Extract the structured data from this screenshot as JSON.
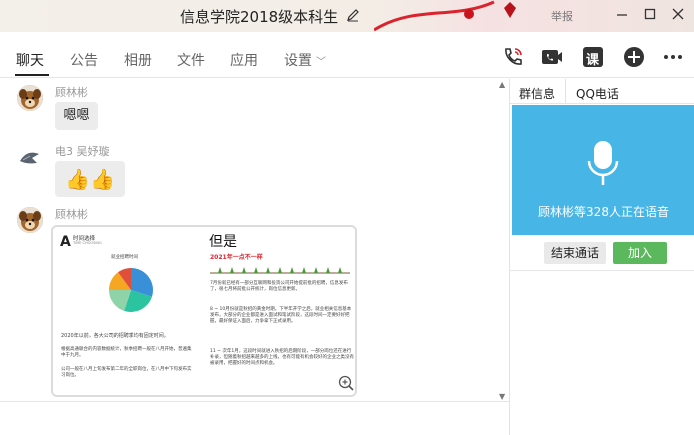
{
  "window": {
    "title": "信息学院2018级本科生",
    "report_label": "举报"
  },
  "tabs": [
    {
      "label": "聊天"
    },
    {
      "label": "公告"
    },
    {
      "label": "相册"
    },
    {
      "label": "文件"
    },
    {
      "label": "应用"
    },
    {
      "label": "设置"
    }
  ],
  "toolbar": {
    "class_label": "课"
  },
  "messages": [
    {
      "sender": "顾林彬",
      "text": "嗯嗯"
    },
    {
      "sender_badge": "电3",
      "sender": "吴妤璇",
      "text": "👍👍"
    },
    {
      "sender": "顾林彬"
    }
  ],
  "image_card": {
    "left": {
      "logo_letter": "A",
      "heading": "时间选择",
      "subheading": "TIME CHOOSING",
      "chart_caption": "就业招聘时间",
      "para1": "2020年以前，各大公司的招聘季均有固定时间。",
      "para2": "根据高通联合的内容数据统计，秋季招聘一般在八月开始，普遍集中于九月。",
      "para3": "公司一般在八月上旬发布第二年的全职岗位，在八月中下旬发布实习岗位。"
    },
    "right": {
      "title": "但是",
      "year_line": "2021年一点不一样",
      "p1": "7月份就已经有一部分互联网和投资公司开始提前批的招聘，信息发布了，很七月将前批公开统计，岗位信息更新。",
      "p2": "8 ~ 10月份就是秋招的黄金时期，下半年开学之后，就业相关信息基本发布，大部分的企业都是进入面试和笔试阶段，这段时间一定要好好把握，最好保证入面后，力争拿下正式录用。",
      "p3": "11 ~ 次年1月，这段时间就进入秋招的后期阶段，一部分岗位还在进行补录，但随着秋招越来越多的上线，也有可能有机会较好的企业之类没有被录用，把握好的时间点和机会。"
    }
  },
  "right_panel": {
    "tabs": [
      {
        "label": "群信息"
      },
      {
        "label": "QQ电话"
      }
    ],
    "voice_text": "顾林彬等328人正在语音",
    "end_call_label": "结束通话",
    "join_label": "加入"
  },
  "colors": {
    "voice_bg": "#47b6e6",
    "join_btn": "#5cb85c",
    "accent_red": "#d9232d"
  },
  "chart_data": {
    "type": "pie",
    "title": "就业招聘时间",
    "slices": [
      {
        "value": 30,
        "color": "#3a8fd9"
      },
      {
        "value": 25,
        "color": "#2cc4a0"
      },
      {
        "value": 20,
        "color": "#8fd3a8"
      },
      {
        "value": 15,
        "color": "#f5a623"
      },
      {
        "value": 10,
        "color": "#e04f3a"
      }
    ]
  }
}
